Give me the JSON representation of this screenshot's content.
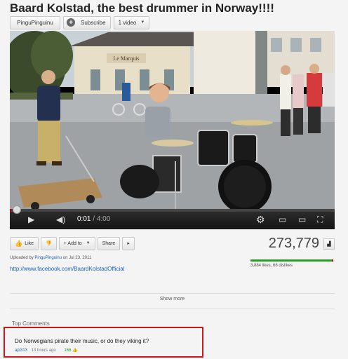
{
  "video": {
    "title": "Baard Kolstad, the best drummer in Norway!!!!",
    "channel": "PinguPinguinu",
    "subscribe_label": "Subscribe",
    "videos_label": "1 video"
  },
  "player": {
    "progress": 0.004,
    "current_time": "0:01",
    "total_time": "4:00",
    "sign_text": "Le Marquis",
    "separator": " / "
  },
  "actions": {
    "like_label": "Like",
    "add_to_label": "+ Add to",
    "share_label": "Share",
    "view_count": "273,779"
  },
  "details": {
    "uploaded_prefix": "Uploaded by",
    "uploader": "PinguPinguinu",
    "uploaded_date": "on Jul 23, 2011",
    "link": "http://www.facebook.com/BaardKolstadOfficial",
    "likes_text": "3,884 likes, 68 dislikes",
    "like_ratio": 0.98
  },
  "show_more_label": "Show more",
  "comments": {
    "heading": "Top Comments",
    "items": [
      {
        "text": "Do Norwegians pirate their music, or do they viking it?",
        "author": "api313",
        "age": "13 hours ago",
        "votes": "166"
      }
    ]
  },
  "colors": {
    "link": "#1c62b9",
    "highlight_border": "#d01818",
    "like_bar": "#2a9e28",
    "dislike_bar": "#cc0000"
  }
}
